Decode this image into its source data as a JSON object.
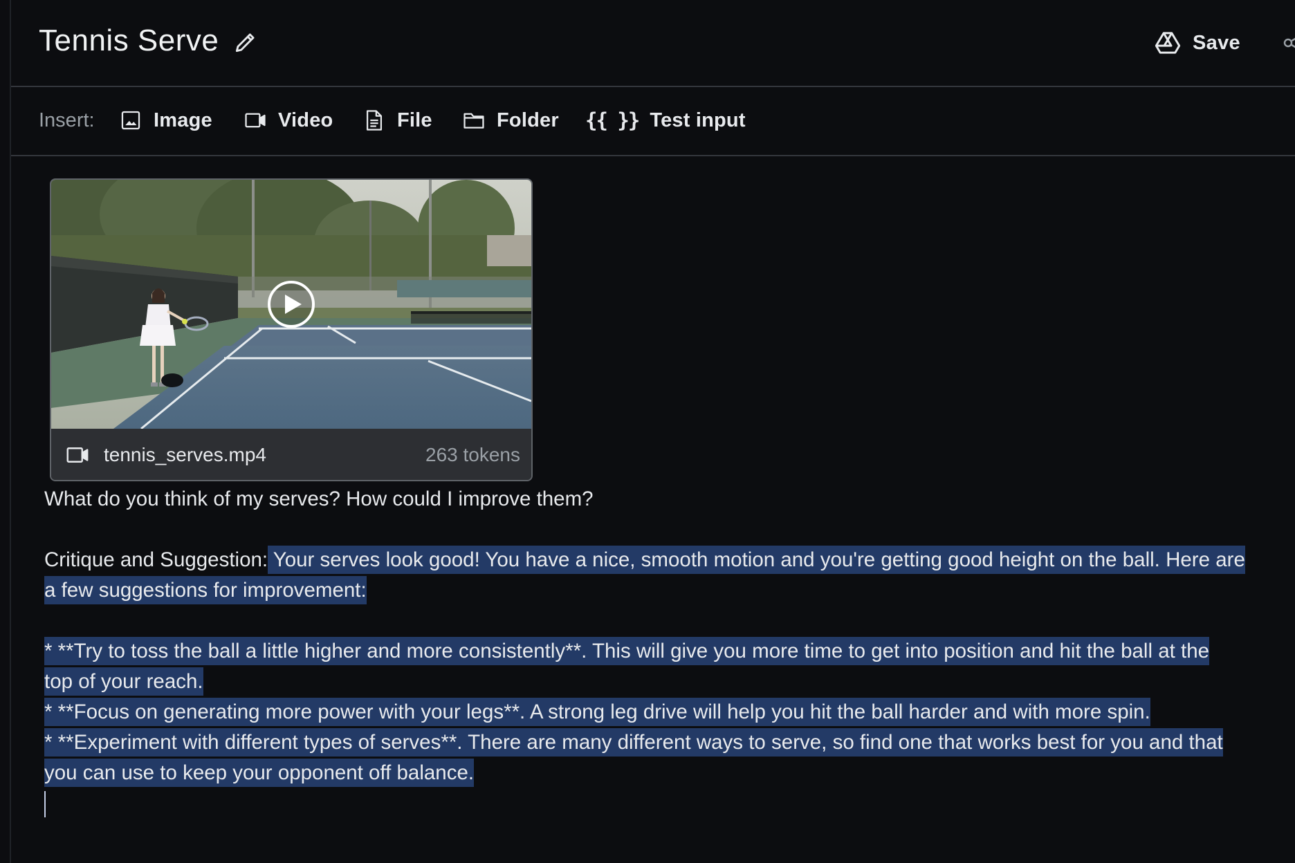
{
  "header": {
    "title": "Tennis Serve",
    "save_label": "Save"
  },
  "toolbar": {
    "insert_label": "Insert:",
    "items": [
      {
        "label": "Image",
        "icon": "image-icon"
      },
      {
        "label": "Video",
        "icon": "video-icon"
      },
      {
        "label": "File",
        "icon": "file-icon"
      },
      {
        "label": "Folder",
        "icon": "folder-icon"
      },
      {
        "label": "Test input",
        "icon": "braces-icon",
        "glyph": "{{ }}"
      }
    ]
  },
  "attachment": {
    "filename": "tennis_serves.mp4",
    "tokens": "263 tokens",
    "type_icon": "video-icon",
    "thumbnail_icon": "play-icon"
  },
  "prompt": {
    "question": "What do you think of my serves? How could I improve them?",
    "critique_prefix": "Critique and Suggestion:",
    "critique_line1": " Your serves look good! You have a nice, smooth motion and you're getting good height on the ball. Here are",
    "critique_line2": "a few suggestions for improvement:",
    "bullet1_line1": "* **Try to toss the ball a little higher and more consistently**. This will give you more time to get into position and hit the ball at the",
    "bullet1_line2": "top of your reach.",
    "bullet2": "* **Focus on generating more power with your legs**. A strong leg drive will help you hit the ball harder and with more spin.",
    "bullet3_line1": "* **Experiment with different types of serves**. There are many different ways to serve, so find one that works best for you and that",
    "bullet3_line2": "you can use to keep your opponent off balance."
  },
  "colors": {
    "background": "#0c0d10",
    "selection_highlight": "#233a66",
    "card_footer": "#2d2f33",
    "muted_text": "#9aa0a6"
  }
}
